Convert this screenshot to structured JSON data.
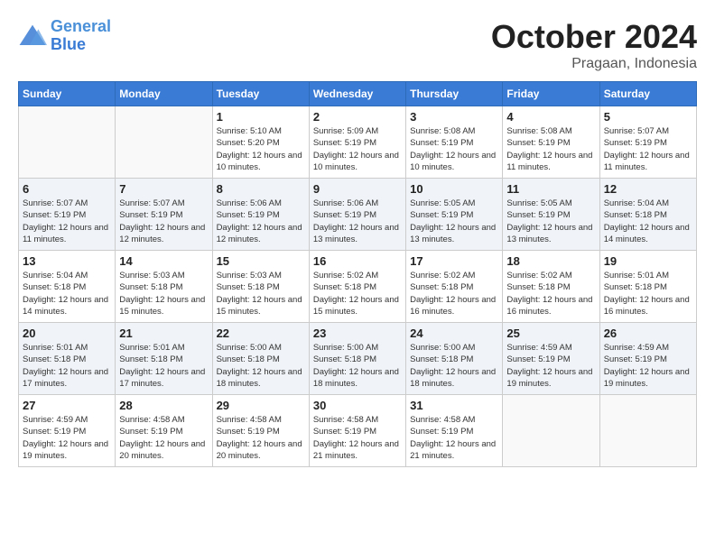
{
  "header": {
    "logo_line1": "General",
    "logo_line2": "Blue",
    "month": "October 2024",
    "location": "Pragaan, Indonesia"
  },
  "days_of_week": [
    "Sunday",
    "Monday",
    "Tuesday",
    "Wednesday",
    "Thursday",
    "Friday",
    "Saturday"
  ],
  "weeks": [
    [
      {
        "day": "",
        "info": ""
      },
      {
        "day": "",
        "info": ""
      },
      {
        "day": "1",
        "info": "Sunrise: 5:10 AM\nSunset: 5:20 PM\nDaylight: 12 hours\nand 10 minutes."
      },
      {
        "day": "2",
        "info": "Sunrise: 5:09 AM\nSunset: 5:19 PM\nDaylight: 12 hours\nand 10 minutes."
      },
      {
        "day": "3",
        "info": "Sunrise: 5:08 AM\nSunset: 5:19 PM\nDaylight: 12 hours\nand 10 minutes."
      },
      {
        "day": "4",
        "info": "Sunrise: 5:08 AM\nSunset: 5:19 PM\nDaylight: 12 hours\nand 11 minutes."
      },
      {
        "day": "5",
        "info": "Sunrise: 5:07 AM\nSunset: 5:19 PM\nDaylight: 12 hours\nand 11 minutes."
      }
    ],
    [
      {
        "day": "6",
        "info": "Sunrise: 5:07 AM\nSunset: 5:19 PM\nDaylight: 12 hours\nand 11 minutes."
      },
      {
        "day": "7",
        "info": "Sunrise: 5:07 AM\nSunset: 5:19 PM\nDaylight: 12 hours\nand 12 minutes."
      },
      {
        "day": "8",
        "info": "Sunrise: 5:06 AM\nSunset: 5:19 PM\nDaylight: 12 hours\nand 12 minutes."
      },
      {
        "day": "9",
        "info": "Sunrise: 5:06 AM\nSunset: 5:19 PM\nDaylight: 12 hours\nand 13 minutes."
      },
      {
        "day": "10",
        "info": "Sunrise: 5:05 AM\nSunset: 5:19 PM\nDaylight: 12 hours\nand 13 minutes."
      },
      {
        "day": "11",
        "info": "Sunrise: 5:05 AM\nSunset: 5:19 PM\nDaylight: 12 hours\nand 13 minutes."
      },
      {
        "day": "12",
        "info": "Sunrise: 5:04 AM\nSunset: 5:18 PM\nDaylight: 12 hours\nand 14 minutes."
      }
    ],
    [
      {
        "day": "13",
        "info": "Sunrise: 5:04 AM\nSunset: 5:18 PM\nDaylight: 12 hours\nand 14 minutes."
      },
      {
        "day": "14",
        "info": "Sunrise: 5:03 AM\nSunset: 5:18 PM\nDaylight: 12 hours\nand 15 minutes."
      },
      {
        "day": "15",
        "info": "Sunrise: 5:03 AM\nSunset: 5:18 PM\nDaylight: 12 hours\nand 15 minutes."
      },
      {
        "day": "16",
        "info": "Sunrise: 5:02 AM\nSunset: 5:18 PM\nDaylight: 12 hours\nand 15 minutes."
      },
      {
        "day": "17",
        "info": "Sunrise: 5:02 AM\nSunset: 5:18 PM\nDaylight: 12 hours\nand 16 minutes."
      },
      {
        "day": "18",
        "info": "Sunrise: 5:02 AM\nSunset: 5:18 PM\nDaylight: 12 hours\nand 16 minutes."
      },
      {
        "day": "19",
        "info": "Sunrise: 5:01 AM\nSunset: 5:18 PM\nDaylight: 12 hours\nand 16 minutes."
      }
    ],
    [
      {
        "day": "20",
        "info": "Sunrise: 5:01 AM\nSunset: 5:18 PM\nDaylight: 12 hours\nand 17 minutes."
      },
      {
        "day": "21",
        "info": "Sunrise: 5:01 AM\nSunset: 5:18 PM\nDaylight: 12 hours\nand 17 minutes."
      },
      {
        "day": "22",
        "info": "Sunrise: 5:00 AM\nSunset: 5:18 PM\nDaylight: 12 hours\nand 18 minutes."
      },
      {
        "day": "23",
        "info": "Sunrise: 5:00 AM\nSunset: 5:18 PM\nDaylight: 12 hours\nand 18 minutes."
      },
      {
        "day": "24",
        "info": "Sunrise: 5:00 AM\nSunset: 5:18 PM\nDaylight: 12 hours\nand 18 minutes."
      },
      {
        "day": "25",
        "info": "Sunrise: 4:59 AM\nSunset: 5:19 PM\nDaylight: 12 hours\nand 19 minutes."
      },
      {
        "day": "26",
        "info": "Sunrise: 4:59 AM\nSunset: 5:19 PM\nDaylight: 12 hours\nand 19 minutes."
      }
    ],
    [
      {
        "day": "27",
        "info": "Sunrise: 4:59 AM\nSunset: 5:19 PM\nDaylight: 12 hours\nand 19 minutes."
      },
      {
        "day": "28",
        "info": "Sunrise: 4:58 AM\nSunset: 5:19 PM\nDaylight: 12 hours\nand 20 minutes."
      },
      {
        "day": "29",
        "info": "Sunrise: 4:58 AM\nSunset: 5:19 PM\nDaylight: 12 hours\nand 20 minutes."
      },
      {
        "day": "30",
        "info": "Sunrise: 4:58 AM\nSunset: 5:19 PM\nDaylight: 12 hours\nand 21 minutes."
      },
      {
        "day": "31",
        "info": "Sunrise: 4:58 AM\nSunset: 5:19 PM\nDaylight: 12 hours\nand 21 minutes."
      },
      {
        "day": "",
        "info": ""
      },
      {
        "day": "",
        "info": ""
      }
    ]
  ]
}
